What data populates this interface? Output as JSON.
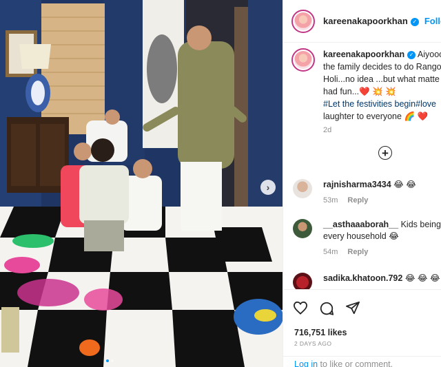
{
  "header": {
    "username": "kareenakapoorkhan",
    "follow_label": "Follo"
  },
  "caption": {
    "username": "kareenakapoorkhan",
    "line1": "Aiyoooo",
    "line2": "the family decides to do Rango",
    "line3": "Holi...no idea ...but what matte",
    "line4": "had fun...",
    "line4_emoji": "❤️ 💥 💥",
    "line5_tag1": "#Let the festivities begin",
    "line5_tag2": "#love",
    "line6": "laughter to everyone",
    "line6_emoji": "🌈 ❤️",
    "time": "2d"
  },
  "comments": [
    {
      "username": "rajnisharma3434",
      "text": "😂 😂",
      "time": "53m",
      "reply": "Reply"
    },
    {
      "username": "__asthaaaborah__",
      "text": "Kids being k",
      "text2": "every household 😂",
      "time": "54m",
      "reply": "Reply"
    },
    {
      "username": "sadika.khatoon.792",
      "text": "😂 😂 😂 😂"
    }
  ],
  "post": {
    "likes": "716,751 likes",
    "date": "2 DAYS AGO",
    "login_link": "Log in",
    "login_rest": " to like or comment."
  },
  "colors": {
    "link": "#0095f6",
    "verified": "#0095f6",
    "muted": "#8e8e8e"
  }
}
